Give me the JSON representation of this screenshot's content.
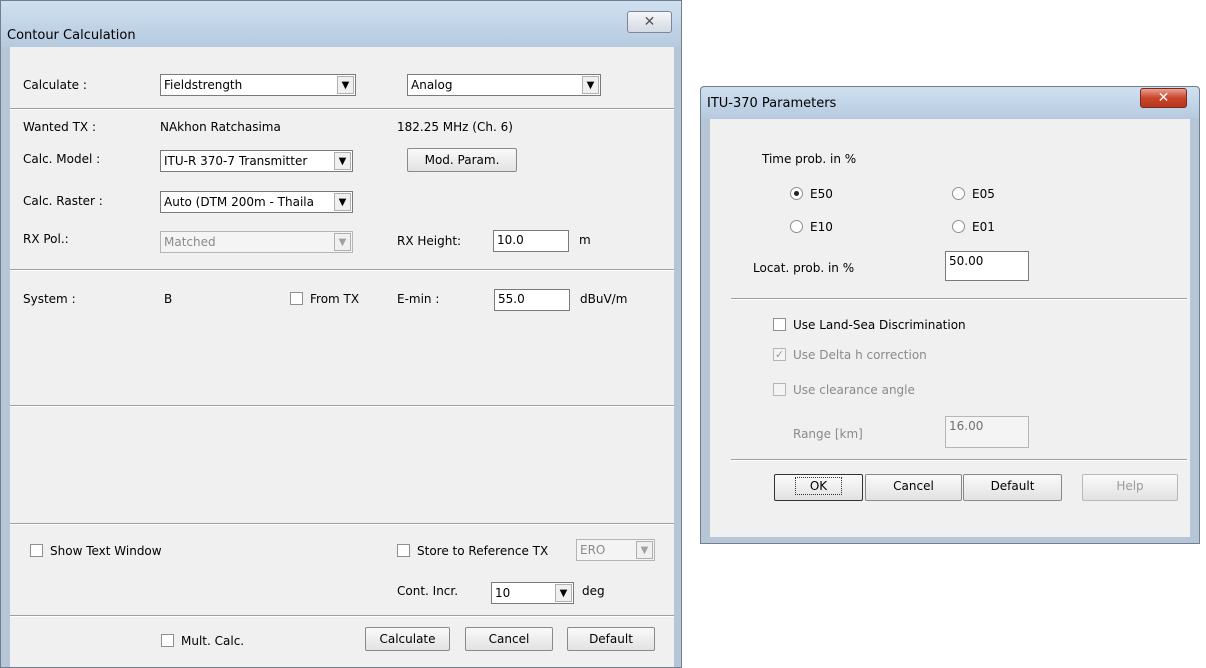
{
  "contour_dialog": {
    "title": "Contour Calculation",
    "close_glyph": "✕",
    "calculate_label": "Calculate :",
    "calculate_value": "Fieldstrength",
    "mode_value": "Analog",
    "wanted_tx_label": "Wanted TX :",
    "wanted_tx_value": "NAkhon Ratchasima",
    "frequency_value": "182.25 MHz (Ch. 6)",
    "calc_model_label": "Calc. Model :",
    "calc_model_value": "ITU-R 370-7 Transmitter",
    "mod_param_label": "Mod. Param.",
    "calc_raster_label": "Calc. Raster :",
    "calc_raster_value": "Auto (DTM 200m - Thaila",
    "rx_pol_label": "RX Pol.:",
    "rx_pol_value": "Matched",
    "rx_height_label": "RX Height:",
    "rx_height_value": "10.0",
    "rx_height_unit": "m",
    "system_label": "System :",
    "system_value": "B",
    "from_tx_label": "From TX",
    "emin_label": "E-min :",
    "emin_value": "55.0",
    "emin_unit": "dBuV/m",
    "show_text_window_label": "Show Text Window",
    "store_ref_label": "Store to Reference TX",
    "store_ref_value": "ERO",
    "cont_incr_label": "Cont. Incr.",
    "cont_incr_value": "10",
    "cont_incr_unit": "deg",
    "mult_calc_label": "Mult. Calc.",
    "calculate_button": "Calculate",
    "cancel_button": "Cancel",
    "default_button": "Default",
    "arrow_glyph": "▼"
  },
  "itu_dialog": {
    "title": "ITU-370 Parameters",
    "close_glyph": "✕",
    "time_prob_label": "Time prob. in %",
    "radio_e50": "E50",
    "radio_e05": "E05",
    "radio_e10": "E10",
    "radio_e01": "E01",
    "selected_radio": "E50",
    "locat_prob_label": "Locat. prob. in %",
    "locat_prob_value": "50.00",
    "land_sea_label": "Use Land-Sea Discrimination",
    "delta_h_label": "Use Delta h correction",
    "clearance_label": "Use clearance angle",
    "range_label": "Range [km]",
    "range_value": "16.00",
    "ok_button": "OK",
    "cancel_button": "Cancel",
    "default_button": "Default",
    "help_button": "Help",
    "check_glyph": "✓"
  }
}
